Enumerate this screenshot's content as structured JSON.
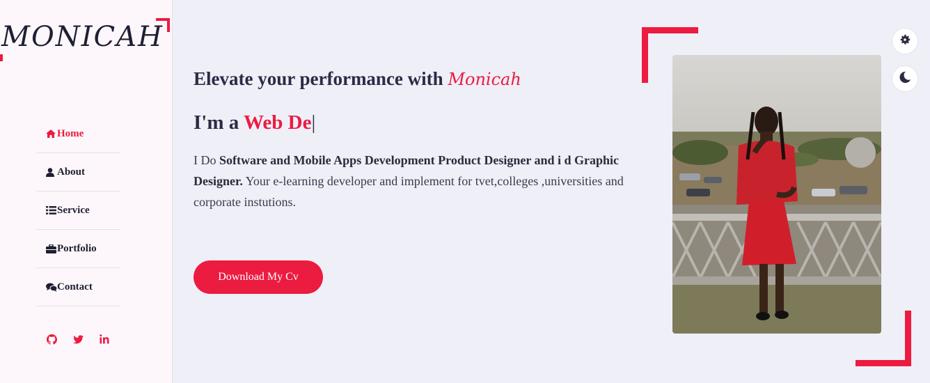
{
  "logo": {
    "text": "MONICAH"
  },
  "nav": {
    "items": [
      {
        "label": "Home",
        "icon": "home-icon",
        "active": true
      },
      {
        "label": "About",
        "icon": "user-icon",
        "active": false
      },
      {
        "label": "Service",
        "icon": "list-icon",
        "active": false
      },
      {
        "label": "Portfolio",
        "icon": "briefcase-icon",
        "active": false
      },
      {
        "label": "Contact",
        "icon": "comments-icon",
        "active": false
      }
    ]
  },
  "social": [
    "github-icon",
    "twitter-icon",
    "linkedin-icon"
  ],
  "hero": {
    "tagline": "Elevate your performance with",
    "brand": "Monicah",
    "typing_prefix": "I'm a",
    "typing_role": "Web De",
    "caret": "|",
    "desc_intro": "I Do",
    "desc_bold": "Software and Mobile Apps Development Product Designer and i d Graphic Designer.",
    "desc_rest": "Your e-learning developer and implement for tvet,colleges ,universities and corporate instutions.",
    "cv_button": "Download My Cv"
  },
  "controls": {
    "settings": "gear-icon",
    "theme": "moon-icon"
  },
  "colors": {
    "accent": "#ec1b40",
    "dark": "#2b2b45",
    "bg": "#efeff8",
    "sidebar_bg": "#fdf7fb"
  }
}
